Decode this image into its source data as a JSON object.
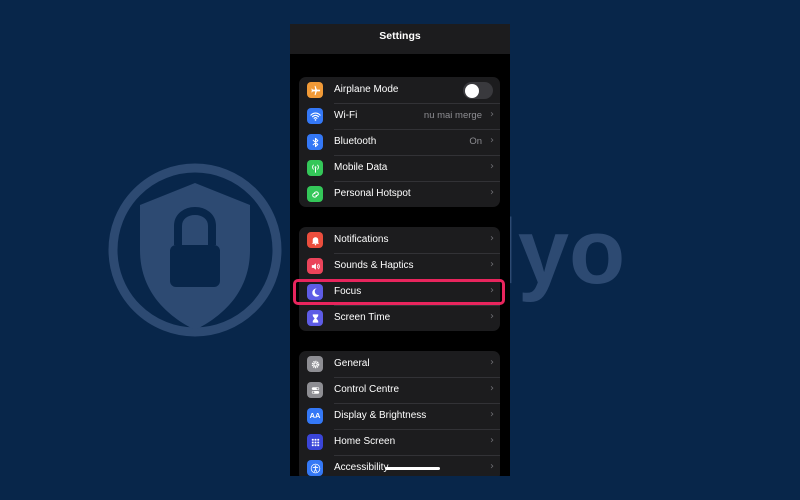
{
  "watermark": {
    "text": "Safelyo"
  },
  "header": {
    "title": "Settings"
  },
  "groups": [
    {
      "rows": [
        {
          "label": "Airplane Mode",
          "value": "",
          "icon": "airplane-icon",
          "color": "#f19a37",
          "toggle": false
        },
        {
          "label": "Wi-Fi",
          "value": "nu mai merge",
          "icon": "wifi-icon",
          "color": "#3478f6"
        },
        {
          "label": "Bluetooth",
          "value": "On",
          "icon": "bluetooth-icon",
          "color": "#3478f6"
        },
        {
          "label": "Mobile Data",
          "value": "",
          "icon": "antenna-icon",
          "color": "#34c759"
        },
        {
          "label": "Personal Hotspot",
          "value": "",
          "icon": "hotspot-icon",
          "color": "#34c759"
        }
      ]
    },
    {
      "rows": [
        {
          "label": "Notifications",
          "value": "",
          "icon": "notification-icon",
          "color": "#eb4e3d"
        },
        {
          "label": "Sounds & Haptics",
          "value": "",
          "icon": "speaker-icon",
          "color": "#eb445a"
        },
        {
          "label": "Focus",
          "value": "",
          "icon": "moon-icon",
          "color": "#5e5ce6",
          "highlighted": true
        },
        {
          "label": "Screen Time",
          "value": "",
          "icon": "hourglass-icon",
          "color": "#5e5ce6"
        }
      ]
    },
    {
      "rows": [
        {
          "label": "General",
          "value": "",
          "icon": "gear-icon",
          "color": "#8e8e93"
        },
        {
          "label": "Control Centre",
          "value": "",
          "icon": "switches-icon",
          "color": "#8e8e93"
        },
        {
          "label": "Display & Brightness",
          "value": "",
          "icon": "text-size-icon",
          "color": "#3478f6",
          "icon_text": "AA"
        },
        {
          "label": "Home Screen",
          "value": "",
          "icon": "grid-icon",
          "color": "#3a45d8"
        },
        {
          "label": "Accessibility",
          "value": "",
          "icon": "accessibility-icon",
          "color": "#3478f6"
        }
      ]
    }
  ]
}
